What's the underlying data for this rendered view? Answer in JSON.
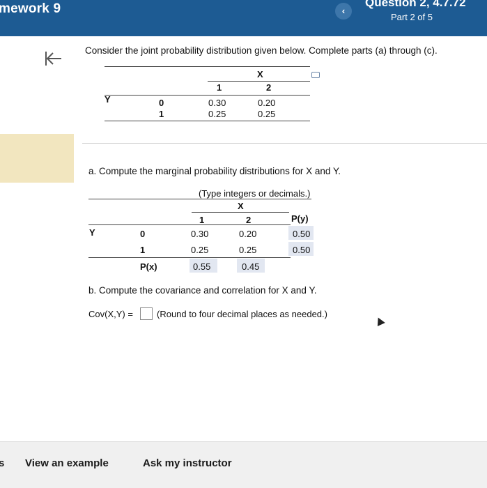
{
  "header": {
    "homework_title": "mework 9",
    "question_title": "Question 2, 4.7.72",
    "part_label": "Part 2 of 5",
    "prev_glyph": "‹"
  },
  "problem": {
    "prompt": "Consider the joint probability distribution given below. Complete parts (a) through (c).",
    "table": {
      "x_header": "X",
      "y_header": "Y",
      "x_values": [
        "1",
        "2"
      ],
      "y_values": [
        "0",
        "1"
      ],
      "cells": [
        [
          "0.30",
          "0.20"
        ],
        [
          "0.25",
          "0.25"
        ]
      ]
    }
  },
  "part_a": {
    "instruction": "a. Compute the marginal probability distributions for X and Y.",
    "hint": "(Type integers or decimals.)",
    "x_header": "X",
    "y_header": "Y",
    "x_values": [
      "1",
      "2"
    ],
    "y_values": [
      "0",
      "1"
    ],
    "py_header": "P(y)",
    "px_label": "P(x)",
    "cells": [
      [
        "0.30",
        "0.20"
      ],
      [
        "0.25",
        "0.25"
      ]
    ],
    "py": [
      "0.50",
      "0.50"
    ],
    "px": [
      "0.55",
      "0.45"
    ]
  },
  "part_b": {
    "instruction": "b. Compute the covariance and correlation for X and Y.",
    "cov_label": "Cov(X,Y) =",
    "cov_value": "",
    "round_note": "(Round to four decimal places as needed.)"
  },
  "footer": {
    "left_glyph": "s",
    "view_example": "View an example",
    "ask_instructor": "Ask my instructor"
  }
}
